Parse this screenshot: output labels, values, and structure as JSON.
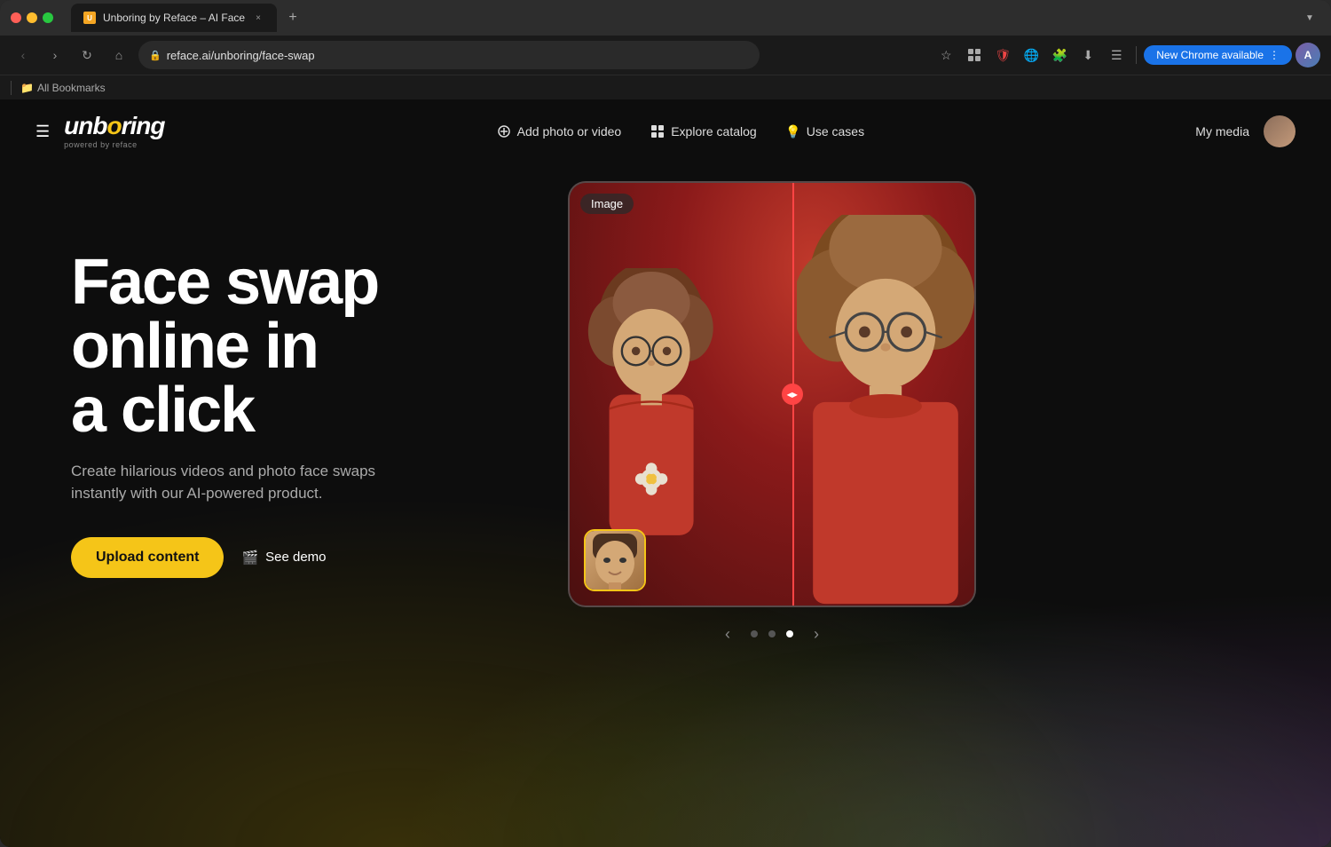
{
  "browser": {
    "traffic_lights": [
      "red",
      "yellow",
      "green"
    ],
    "tab": {
      "favicon": "U",
      "title": "Unboring by Reface – AI Face...",
      "close_symbol": "×"
    },
    "tab_new_symbol": "+",
    "tab_dropdown_symbol": "▼",
    "nav": {
      "back_symbol": "‹",
      "forward_symbol": "›",
      "refresh_symbol": "↻",
      "home_symbol": "⌂"
    },
    "url_lock": "🔒",
    "url": "reface.ai/unboring/face-swap",
    "icons": [
      "☆",
      "⬇",
      "🛡",
      "🌐",
      "🧩",
      "⬇",
      "☰"
    ],
    "chrome_update_label": "New Chrome available",
    "chrome_update_dots": "⋮",
    "bookmarks": {
      "divider": true,
      "folder_icon": "📁",
      "label": "All Bookmarks"
    }
  },
  "site": {
    "nav": {
      "menu_icon": "☰",
      "logo": {
        "text_before_o": "unb",
        "o_yellow": "o",
        "text_after_o": "ring",
        "powered_by": "powered by reface"
      },
      "links": [
        {
          "icon": "＋",
          "label": "Add photo or video"
        },
        {
          "icon": "⊞",
          "label": "Explore catalog"
        },
        {
          "icon": "💡",
          "label": "Use cases"
        }
      ],
      "my_media": "My media",
      "avatar_initials": "A"
    },
    "hero": {
      "title_line1": "Face swap online in",
      "title_line2": "a click",
      "subtitle": "Create hilarious videos and photo face swaps\ninstantly with our AI-powered product.",
      "upload_btn": "Upload content",
      "demo_btn": "See demo",
      "demo_icon": "🎬"
    },
    "image_card": {
      "label": "Image",
      "divider_handle": "◀▶"
    },
    "pagination": {
      "prev": "‹",
      "next": "›",
      "dots": [
        false,
        false,
        true
      ]
    }
  }
}
